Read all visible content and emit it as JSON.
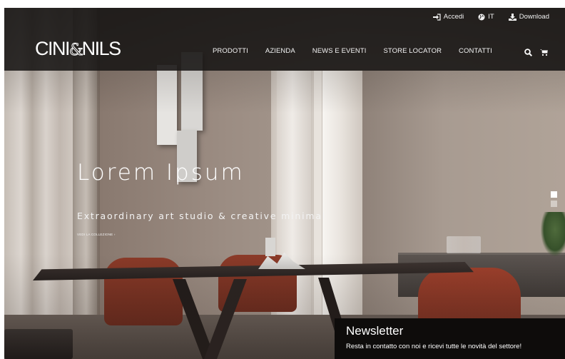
{
  "topbar": {
    "login_label": "Accedi",
    "language_label": "IT",
    "download_label": "Download"
  },
  "brand": {
    "logo_left": "CINI",
    "logo_amp": "&",
    "logo_right": "NILS"
  },
  "nav": {
    "items": [
      {
        "label": "PRODOTTI"
      },
      {
        "label": "AZIENDA"
      },
      {
        "label": "NEWS E EVENTI"
      },
      {
        "label": "STORE LOCATOR"
      },
      {
        "label": "CONTATTI"
      }
    ]
  },
  "hero": {
    "title": "Lorem Ipsum",
    "subtitle": "Extraordinary art studio & creative minimal",
    "link_label": "VEDI LA COLLEZIONE ›"
  },
  "slider": {
    "slide_count": 2,
    "active_index": 0
  },
  "newsletter": {
    "title": "Newsletter",
    "text": "Resta in contatto con noi e ricevi tutte le novità del settore!"
  },
  "icons": {
    "login": "sign-in-icon",
    "language": "globe-icon",
    "download": "download-icon",
    "search": "search-icon",
    "cart": "cart-icon"
  },
  "colors": {
    "header_bg": "#181615",
    "newsletter_bg": "#0e0c0b",
    "text": "#ffffff"
  }
}
